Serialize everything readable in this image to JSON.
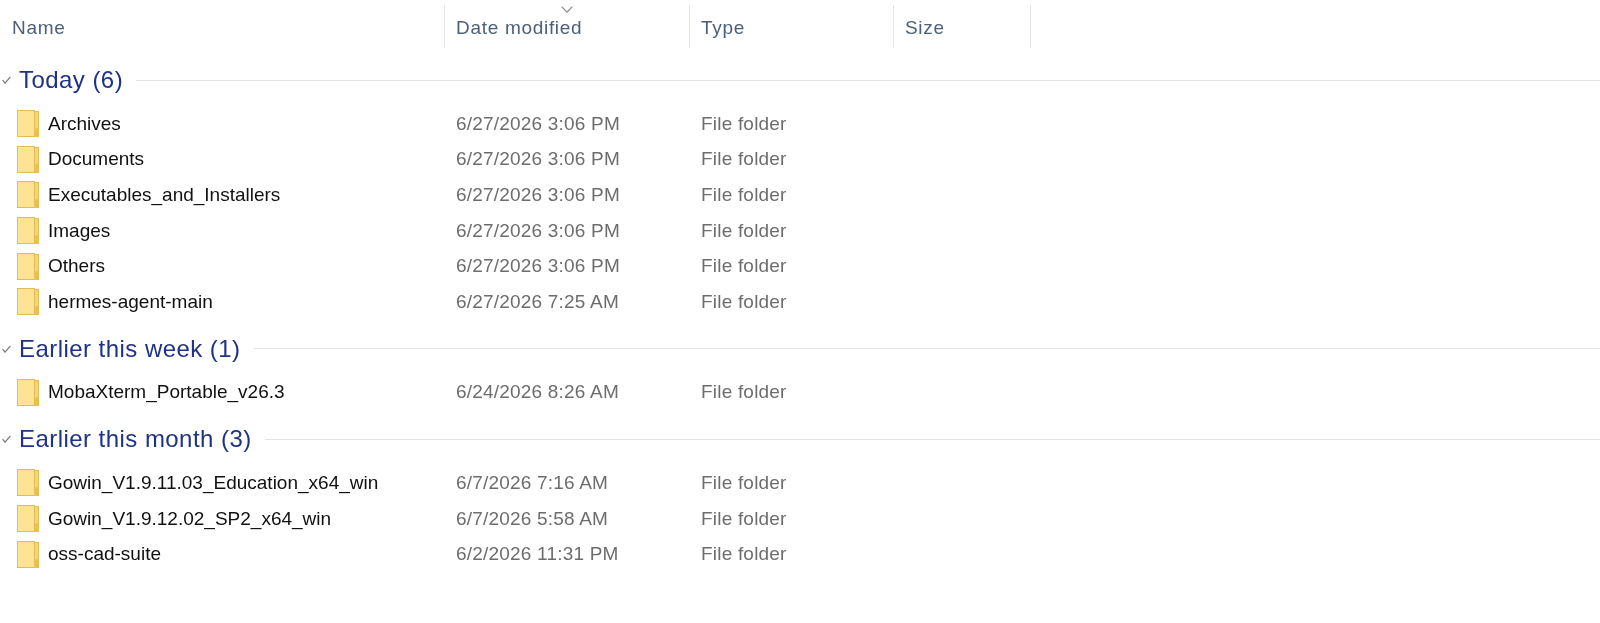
{
  "columns": [
    {
      "label": "Name",
      "sorted": false
    },
    {
      "label": "Date modified",
      "sorted": true
    },
    {
      "label": "Type",
      "sorted": false
    },
    {
      "label": "Size",
      "sorted": false
    }
  ],
  "groups": [
    {
      "title": "Today (6)",
      "expanded": true,
      "items": [
        {
          "name": "Archives",
          "date_modified": "6/27/2026 3:06 PM",
          "type": "File folder"
        },
        {
          "name": "Documents",
          "date_modified": "6/27/2026 3:06 PM",
          "type": "File folder"
        },
        {
          "name": "Executables_and_Installers",
          "date_modified": "6/27/2026 3:06 PM",
          "type": "File folder"
        },
        {
          "name": "Images",
          "date_modified": "6/27/2026 3:06 PM",
          "type": "File folder"
        },
        {
          "name": "Others",
          "date_modified": "6/27/2026 3:06 PM",
          "type": "File folder"
        },
        {
          "name": "hermes-agent-main",
          "date_modified": "6/27/2026 7:25 AM",
          "type": "File folder"
        }
      ]
    },
    {
      "title": "Earlier this week (1)",
      "expanded": true,
      "items": [
        {
          "name": "MobaXterm_Portable_v26.3",
          "date_modified": "6/24/2026 8:26 AM",
          "type": "File folder"
        }
      ]
    },
    {
      "title": "Earlier this month (3)",
      "expanded": true,
      "items": [
        {
          "name": "Gowin_V1.9.11.03_Education_x64_win",
          "date_modified": "6/7/2026 7:16 AM",
          "type": "File folder"
        },
        {
          "name": "Gowin_V1.9.12.02_SP2_x64_win",
          "date_modified": "6/7/2026 5:58 AM",
          "type": "File folder"
        },
        {
          "name": "oss-cad-suite",
          "date_modified": "6/2/2026 11:31 PM",
          "type": "File folder"
        }
      ]
    }
  ]
}
